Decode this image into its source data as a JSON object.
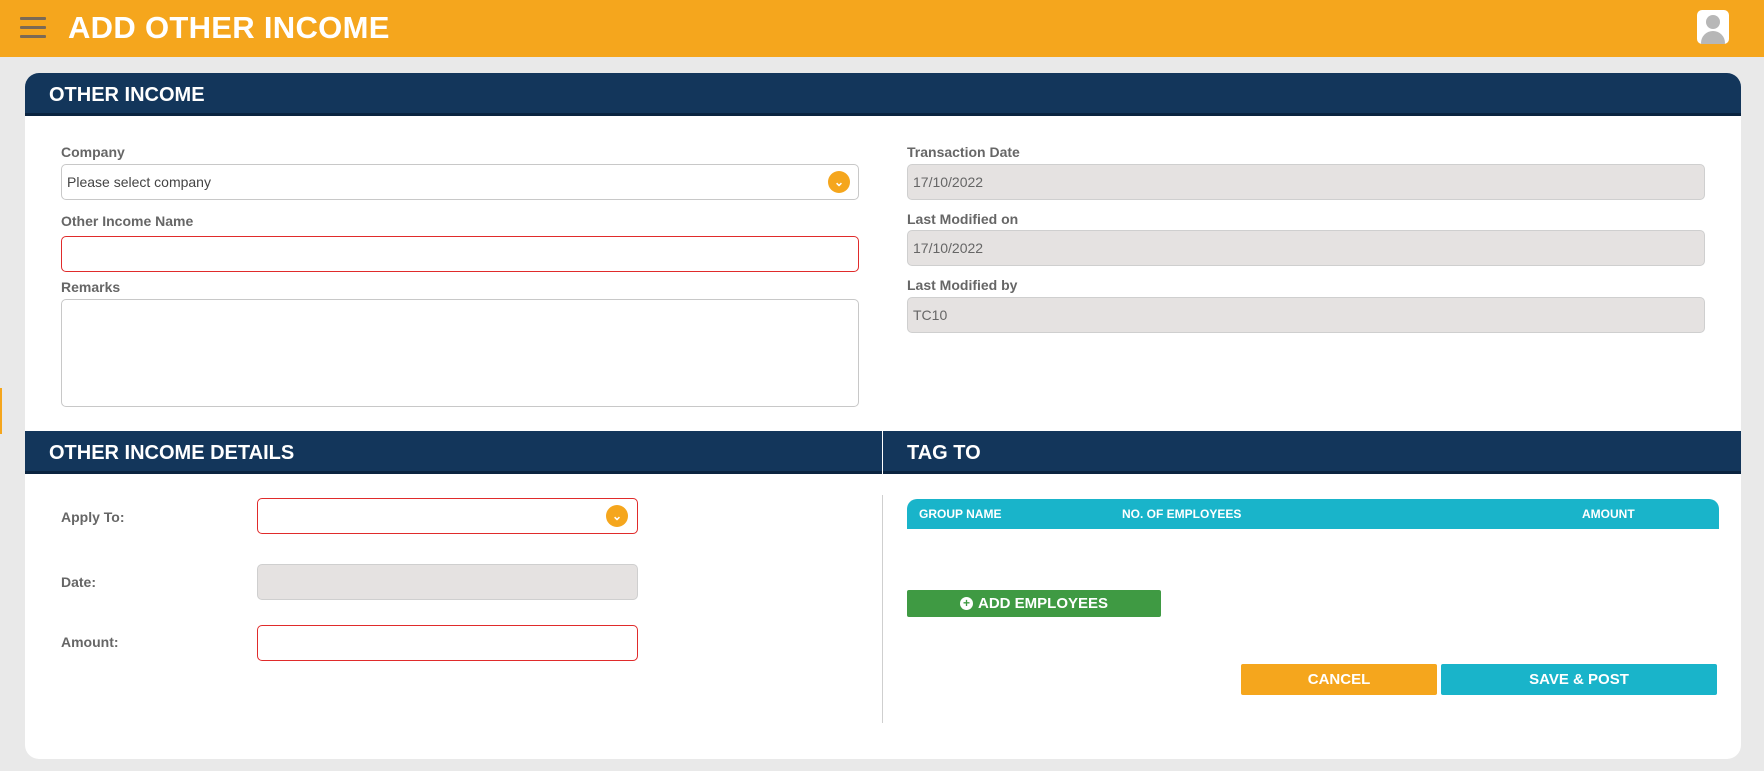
{
  "header": {
    "title": "ADD OTHER INCOME"
  },
  "other_income": {
    "heading": "OTHER INCOME",
    "company_label": "Company",
    "company_placeholder": "Please select company",
    "name_label": "Other Income Name",
    "name_value": "",
    "remarks_label": "Remarks",
    "remarks_value": "",
    "transaction_date_label": "Transaction Date",
    "transaction_date_value": "17/10/2022",
    "last_modified_on_label": "Last Modified on",
    "last_modified_on_value": "17/10/2022",
    "last_modified_by_label": "Last Modified by",
    "last_modified_by_value": "TC10"
  },
  "details": {
    "heading": "OTHER INCOME DETAILS",
    "apply_to_label": "Apply To:",
    "apply_to_value": "",
    "date_label": "Date:",
    "date_value": "",
    "amount_label": "Amount:",
    "amount_value": ""
  },
  "tag_to": {
    "heading": "TAG TO",
    "columns": [
      "GROUP NAME",
      "NO. OF EMPLOYEES",
      "AMOUNT"
    ],
    "rows": [],
    "add_button": "ADD EMPLOYEES"
  },
  "actions": {
    "cancel": "CANCEL",
    "save_post": "SAVE & POST"
  },
  "colors": {
    "accent": "#f5a61d",
    "header_navy": "#13365b",
    "teal": "#19b4ca",
    "green": "#3f9a43",
    "error": "#e02b2b"
  },
  "icons": [
    "hamburger-menu-icon",
    "user-avatar-icon",
    "chevron-down-icon",
    "plus-circle-icon"
  ]
}
